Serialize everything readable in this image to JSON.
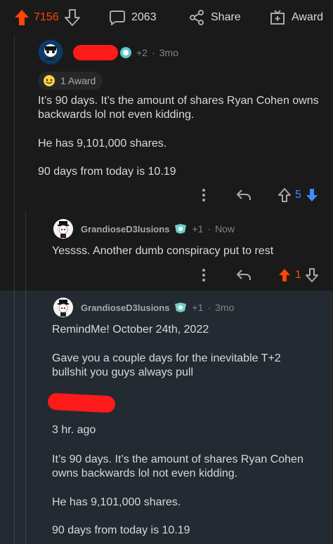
{
  "topbar": {
    "vote_count": "7156",
    "comment_count": "2063",
    "share_label": "Share",
    "award_label": "Award"
  },
  "comment1": {
    "extra_awards": "+2",
    "age": "3mo",
    "award_pill": "1 Award",
    "lines": [
      "It’s 90 days. It’s the amount of shares Ryan Cohen owns",
      "backwards lol not even kidding.",
      "He has 9,101,000 shares.",
      "90 days from today is 10.19"
    ],
    "votes": "5"
  },
  "comment2": {
    "username": "GrandioseD3lusions",
    "extra_awards": "+1",
    "age": "Now",
    "text": "Yessss. Another dumb conspiracy put to rest",
    "votes": "1"
  },
  "comment3": {
    "username": "GrandioseD3lusions",
    "extra_awards": "+1",
    "age": "3mo",
    "lines": [
      "RemindMe! October 24th, 2022",
      "Gave you a couple days for the inevitable T+2",
      "bullshit you guys always pull",
      "3 hr. ago",
      "It’s 90 days. It’s the amount of shares Ryan Cohen",
      "owns backwards lol not even kidding.",
      "He has 9,101,000 shares.",
      "90 days from today is 10.19"
    ]
  },
  "colors": {
    "background": "#1a1a1b",
    "highlight_background": "#242a31",
    "upvote": "#ff4500",
    "downvote": "#3d8cff",
    "text": "#d7dadc",
    "muted": "#818384",
    "redaction": "#ff1a1a"
  }
}
